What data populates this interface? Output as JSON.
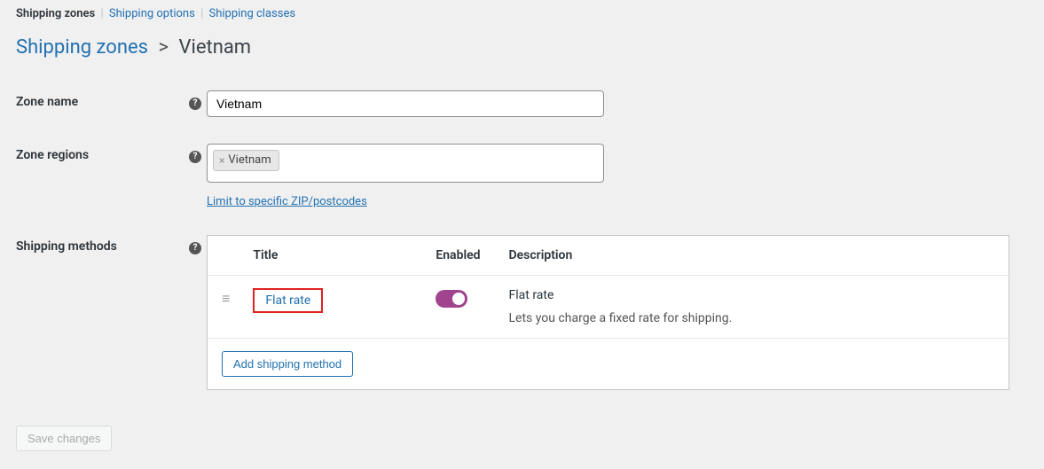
{
  "tabs": {
    "zones": "Shipping zones",
    "options": "Shipping options",
    "classes": "Shipping classes"
  },
  "breadcrumb": {
    "parent": "Shipping zones",
    "current": "Vietnam"
  },
  "form": {
    "zone_name_label": "Zone name",
    "zone_name_value": "Vietnam",
    "zone_regions_label": "Zone regions",
    "zone_regions_tags": [
      "Vietnam"
    ],
    "postcode_link": "Limit to specific ZIP/postcodes",
    "shipping_methods_label": "Shipping methods"
  },
  "methods": {
    "headers": {
      "title": "Title",
      "enabled": "Enabled",
      "description": "Description"
    },
    "rows": [
      {
        "title": "Flat rate",
        "enabled": true,
        "desc_title": "Flat rate",
        "desc_body": "Lets you charge a fixed rate for shipping."
      }
    ],
    "add_button": "Add shipping method"
  },
  "save_button": "Save changes"
}
